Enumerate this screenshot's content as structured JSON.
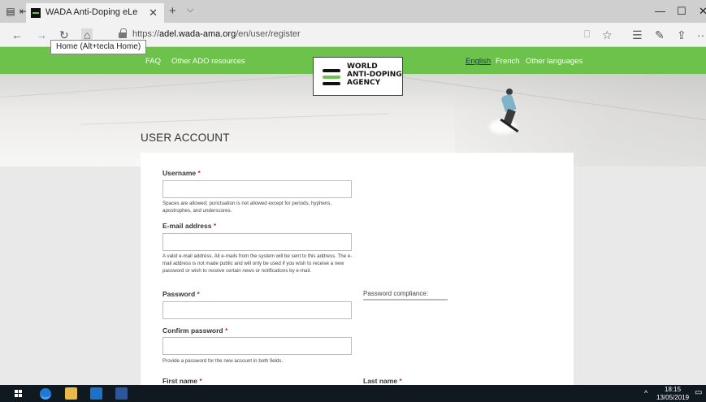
{
  "browser": {
    "tab_title": "WADA Anti-Doping eLe",
    "tab_close": "✕",
    "new_tab": "+",
    "tab_menu": "⌵",
    "url_prefix": "https://",
    "url_host": "adel.wada-ama.org",
    "url_path": "/en/user/register",
    "tooltip": "Home (Alt+tecla Home)",
    "buttons": {
      "back": "←",
      "forward": "→",
      "refresh": "↻",
      "home": "⌂",
      "reading_view": "⎕",
      "favorite": "☆",
      "favorites_hub": "☰",
      "notes": "✎",
      "share": "⇪",
      "more": "···"
    },
    "window": {
      "minimize": "—",
      "maximize": "☐",
      "close": "✕"
    }
  },
  "site": {
    "nav_left": [
      "FAQ",
      "Other ADO resources"
    ],
    "languages": [
      "English",
      "French",
      "Other languages"
    ],
    "active_language": "English",
    "logo_lines": [
      "WORLD",
      "ANTI-DOPING",
      "AGENCY"
    ],
    "accent_color": "#6cc24a"
  },
  "page": {
    "title": "USER ACCOUNT"
  },
  "form": {
    "required_marker": "*",
    "username": {
      "label": "Username",
      "value": "",
      "help": "Spaces are allowed; punctuation is not allowed except for periods, hyphens, apostrophes, and underscores."
    },
    "email": {
      "label": "E-mail address",
      "value": "",
      "help": "A valid e-mail address. All e-mails from the system will be sent to this address. The e-mail address is not made public and will only be used if you wish to receive a new password or wish to receive certain news or notifications by e-mail."
    },
    "password": {
      "label": "Password",
      "value": "",
      "compliance_label": "Password compliance:"
    },
    "confirm_password": {
      "label": "Confirm password",
      "value": "",
      "help": "Provide a password for the new account in both fields."
    },
    "first_name": {
      "label": "First name"
    },
    "last_name": {
      "label": "Last name"
    }
  },
  "taskbar": {
    "time": "18:15",
    "date": "13/05/2019",
    "tray_chevron": "^",
    "notifications": "▭"
  }
}
